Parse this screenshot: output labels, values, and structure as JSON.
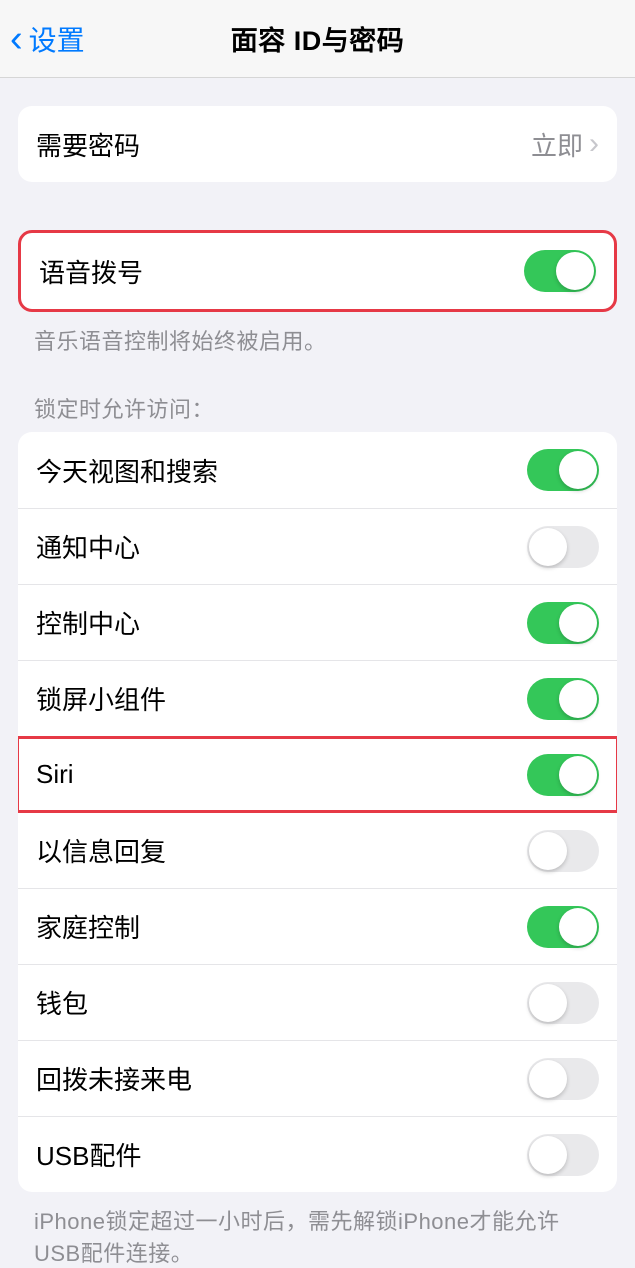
{
  "header": {
    "back_label": "设置",
    "title": "面容 ID与密码"
  },
  "passcode_group": {
    "require_passcode_label": "需要密码",
    "require_passcode_value": "立即"
  },
  "voice_dial": {
    "label": "语音拨号",
    "on": true,
    "footer": "音乐语音控制将始终被启用。"
  },
  "locked_access": {
    "header": "锁定时允许访问：",
    "items": [
      {
        "label": "今天视图和搜索",
        "on": true
      },
      {
        "label": "通知中心",
        "on": false
      },
      {
        "label": "控制中心",
        "on": true
      },
      {
        "label": "锁屏小组件",
        "on": true
      },
      {
        "label": "Siri",
        "on": true
      },
      {
        "label": "以信息回复",
        "on": false
      },
      {
        "label": "家庭控制",
        "on": true
      },
      {
        "label": "钱包",
        "on": false
      },
      {
        "label": "回拨未接来电",
        "on": false
      },
      {
        "label": "USB配件",
        "on": false
      }
    ],
    "footer": "iPhone锁定超过一小时后，需先解锁iPhone才能允许USB配件连接。"
  }
}
